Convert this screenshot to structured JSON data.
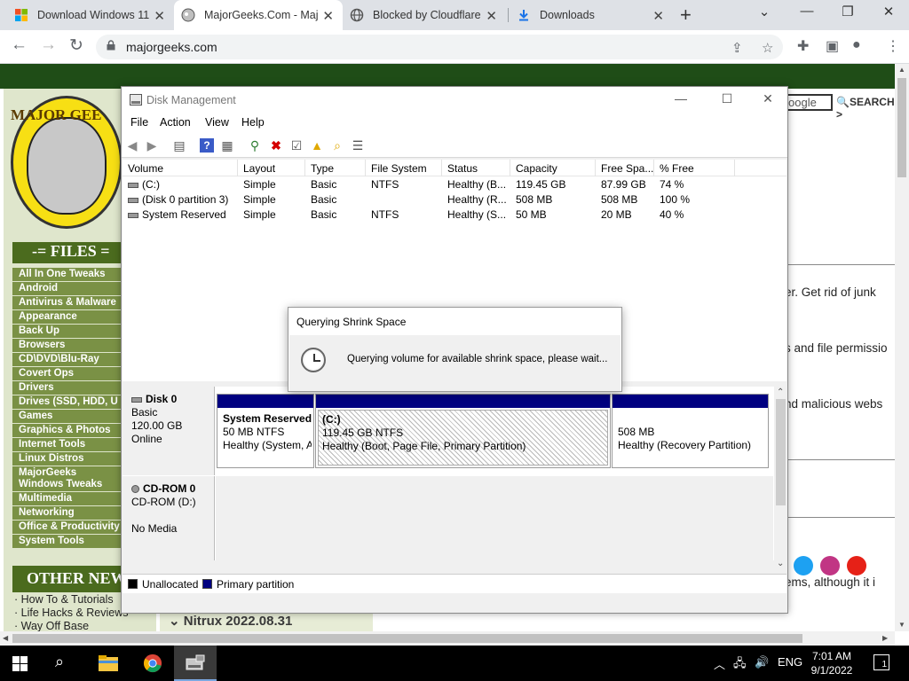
{
  "browser": {
    "tabs": [
      {
        "title": "Download Windows 11",
        "active": false
      },
      {
        "title": "MajorGeeks.Com - Maj",
        "active": true
      },
      {
        "title": "Blocked by Cloudflare",
        "active": false
      },
      {
        "title": "Downloads",
        "active": false
      }
    ],
    "new_tab": "+",
    "url": "majorgeeks.com"
  },
  "site": {
    "logo_text": "MAJOR GEE",
    "files_heading": "-= FILES =",
    "categories": [
      "All In One Tweaks",
      "Android",
      "Antivirus & Malware",
      "Appearance",
      "Back Up",
      "Browsers",
      "CD\\DVD\\Blu-Ray",
      "Covert Ops",
      "Drivers",
      "Drives (SSD, HDD, U",
      "Games",
      "Graphics & Photos",
      "Internet Tools",
      "Linux Distros",
      "MajorGeeks Windows Tweaks",
      "Multimedia",
      "Networking",
      "Office & Productivity",
      "System Tools"
    ],
    "other_heading": "OTHER NEW",
    "other_items": [
      "· How To & Tutorials",
      "· Life Hacks & Reviews",
      "· Way Off Base"
    ],
    "search_box": "oogle",
    "search_label": "SEARCH >",
    "snippets": [
      "er. Get rid of junk",
      "s and file permissio",
      "nd malicious webs",
      "ems, although it i"
    ],
    "featured": "Nitrux 2022.08.31"
  },
  "disk_management": {
    "title": "Disk Management",
    "menu": [
      "File",
      "Action",
      "View",
      "Help"
    ],
    "columns": [
      "Volume",
      "Layout",
      "Type",
      "File System",
      "Status",
      "Capacity",
      "Free Spa...",
      "% Free"
    ],
    "volumes": [
      [
        "(C:)",
        "Simple",
        "Basic",
        "NTFS",
        "Healthy (B...",
        "119.45 GB",
        "87.99 GB",
        "74 %"
      ],
      [
        "(Disk 0 partition 3)",
        "Simple",
        "Basic",
        "",
        "Healthy (R...",
        "508 MB",
        "508 MB",
        "100 %"
      ],
      [
        "System Reserved",
        "Simple",
        "Basic",
        "NTFS",
        "Healthy (S...",
        "50 MB",
        "20 MB",
        "40 %"
      ]
    ],
    "disk0": {
      "name": "Disk 0",
      "type": "Basic",
      "size": "120.00 GB",
      "state": "Online",
      "partitions": [
        {
          "name": "System Reserved",
          "size": "50 MB NTFS",
          "status": "Healthy (System, A"
        },
        {
          "name": "(C:)",
          "size": "119.45 GB NTFS",
          "status": "Healthy (Boot, Page File, Primary Partition)"
        },
        {
          "name": "",
          "size": "508 MB",
          "status": "Healthy (Recovery Partition)"
        }
      ]
    },
    "cdrom": {
      "name": "CD-ROM 0",
      "drive": "CD-ROM (D:)",
      "media": "No Media"
    },
    "legend": [
      {
        "label": "Unallocated",
        "color": "#000000"
      },
      {
        "label": "Primary partition",
        "color": "#000080"
      }
    ]
  },
  "dialog": {
    "title": "Querying Shrink Space",
    "message": "Querying volume for available shrink space, please wait..."
  },
  "taskbar": {
    "time": "7:01 AM",
    "date": "9/1/2022",
    "language": "ENG",
    "notifications": "1"
  }
}
